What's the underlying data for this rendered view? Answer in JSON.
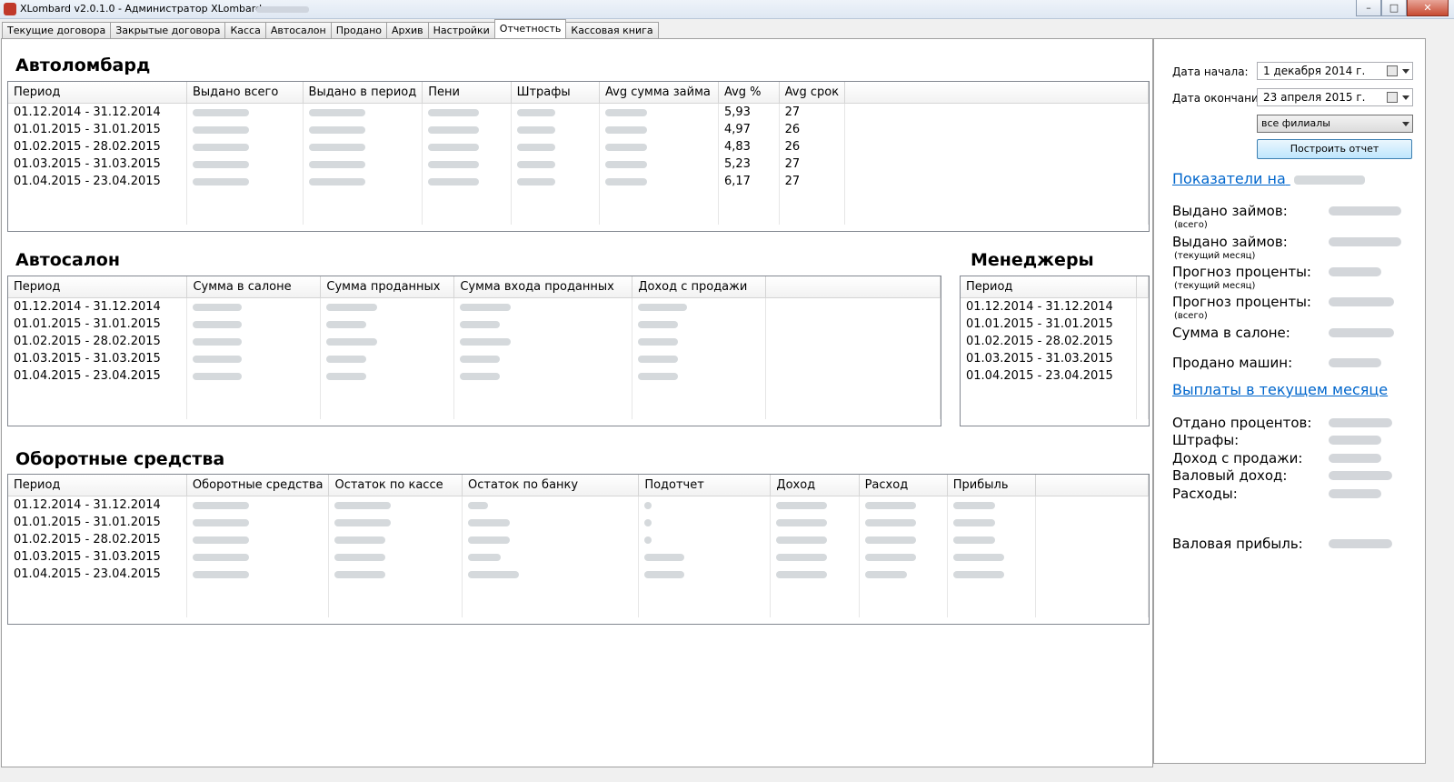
{
  "window": {
    "title": "XLombard v2.0.1.0 - Администратор XLombard,"
  },
  "tabs": [
    "Текущие договора",
    "Закрытые договора",
    "Касса",
    "Автосалон",
    "Продано",
    "Архив",
    "Настройки",
    "Отчетность",
    "Кассовая книга"
  ],
  "active_tab": "Отчетность",
  "autolombard": {
    "title": "Автоломбард",
    "columns": [
      "Период",
      "Выдано всего",
      "Выдано в период",
      "Пени",
      "Штрафы",
      "Avg сумма займа",
      "Avg %",
      "Avg срок"
    ],
    "rows": [
      {
        "period": "01.12.2014 - 31.12.2014",
        "avg_pct": "5,93",
        "avg_term": "27"
      },
      {
        "period": "01.01.2015 - 31.01.2015",
        "avg_pct": "4,97",
        "avg_term": "26"
      },
      {
        "period": "01.02.2015 - 28.02.2015",
        "avg_pct": "4,83",
        "avg_term": "26"
      },
      {
        "period": "01.03.2015 - 31.03.2015",
        "avg_pct": "5,23",
        "avg_term": "27"
      },
      {
        "period": "01.04.2015 - 23.04.2015",
        "avg_pct": "6,17",
        "avg_term": "27"
      }
    ]
  },
  "autosalon": {
    "title": "Автосалон",
    "columns": [
      "Период",
      "Сумма в салоне",
      "Сумма проданных",
      "Сумма входа проданных",
      "Доход с продажи"
    ],
    "rows": [
      "01.12.2014 - 31.12.2014",
      "01.01.2015 - 31.01.2015",
      "01.02.2015 - 28.02.2015",
      "01.03.2015 - 31.03.2015",
      "01.04.2015 - 23.04.2015"
    ]
  },
  "managers": {
    "title": "Менеджеры",
    "columns": [
      "Период"
    ],
    "rows": [
      "01.12.2014 - 31.12.2014",
      "01.01.2015 - 31.01.2015",
      "01.02.2015 - 28.02.2015",
      "01.03.2015 - 31.03.2015",
      "01.04.2015 - 23.04.2015"
    ]
  },
  "working_capital": {
    "title": "Оборотные средства",
    "columns": [
      "Период",
      "Оборотные средства",
      "Остаток по кассе",
      "Остаток по банку",
      "Подотчет",
      "Доход",
      "Расход",
      "Прибыль"
    ],
    "rows": [
      "01.12.2014 - 31.12.2014",
      "01.01.2015 - 31.01.2015",
      "01.02.2015 - 28.02.2015",
      "01.03.2015 - 31.03.2015",
      "01.04.2015 - 23.04.2015"
    ]
  },
  "panel": {
    "start_label": "Дата начала:",
    "start_value": "1  декабря  2014 г.",
    "end_label": "Дата окончания:",
    "end_value": "23  апреля   2015 г.",
    "branch_value": "все филиалы",
    "build_button": "Построить отчет",
    "indicators_link": "Показатели на",
    "indicators": [
      {
        "label": "Выдано займов:",
        "sub": "(всего)"
      },
      {
        "label": "Выдано займов:",
        "sub": "(текущий месяц)"
      },
      {
        "label": "Прогноз проценты:",
        "sub": "(текущий месяц)"
      },
      {
        "label": "Прогноз проценты:",
        "sub": "(всего)"
      },
      {
        "label": "Сумма в салоне:",
        "sub": ""
      },
      {
        "label": "Продано машин:",
        "sub": ""
      }
    ],
    "payments_link": "Выплаты в текущем месяце",
    "payments": [
      "Отдано процентов:",
      "Штрафы:",
      "Доход с продажи:",
      "Валовый доход:",
      "Расходы:"
    ],
    "gross_profit_label": "Валовая прибыль:"
  }
}
